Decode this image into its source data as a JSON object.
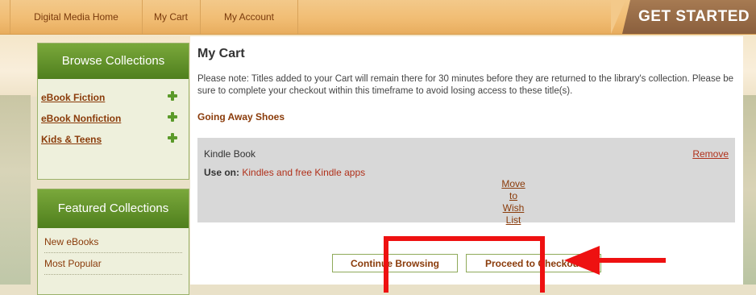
{
  "nav": {
    "home": "Digital Media Home",
    "cart": "My Cart",
    "account": "My Account",
    "get_started": "GET STARTED"
  },
  "sidebar": {
    "browse_title": "Browse Collections",
    "browse_items": [
      "eBook Fiction",
      "eBook Nonfiction",
      "Kids & Teens"
    ],
    "featured_title": "Featured Collections",
    "featured_items": [
      "New eBooks",
      "Most Popular"
    ]
  },
  "main": {
    "title": "My Cart",
    "notice": "Please note: Titles added to your Cart will remain there for 30 minutes before they are returned to the library's collection. Please be sure to complete your checkout within this timeframe to avoid losing access to these title(s).",
    "item_title": "Going Away Shoes",
    "format": "Kindle Book",
    "remove": "Remove",
    "use_on_label": "Use on:",
    "use_on_value": "Kindles and free Kindle apps",
    "move_to_wish_list": [
      "Move to",
      "Wish",
      "List"
    ],
    "continue_label": "Continue Browsing",
    "checkout_label": "Proceed to Checkout"
  },
  "colors": {
    "annotation": "#ee1111",
    "accent_link": "#8a3b0a",
    "panel_green": "#4f7f1d"
  }
}
